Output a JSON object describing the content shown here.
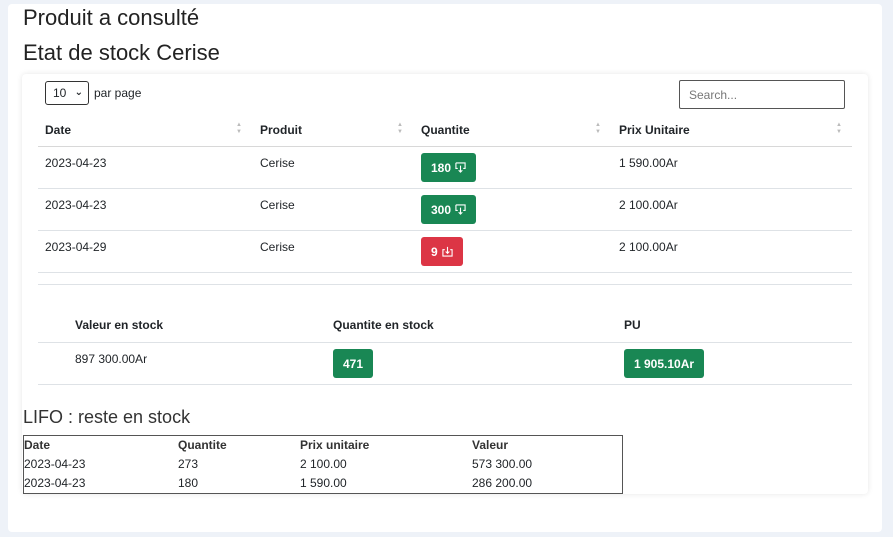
{
  "header": {
    "title": "Produit a consulté",
    "subtitle": "Etat de stock Cerise"
  },
  "controls": {
    "per_page_value": "10",
    "per_page_label": "par page",
    "search_placeholder": "Search..."
  },
  "stock_table": {
    "columns": [
      "Date",
      "Produit",
      "Quantite",
      "Prix Unitaire"
    ],
    "rows": [
      {
        "date": "2023-04-23",
        "produit": "Cerise",
        "quantite": "180",
        "type": "entree",
        "prix": "1 590.00Ar"
      },
      {
        "date": "2023-04-23",
        "produit": "Cerise",
        "quantite": "300",
        "type": "entree",
        "prix": "2 100.00Ar"
      },
      {
        "date": "2023-04-29",
        "produit": "Cerise",
        "quantite": "9",
        "type": "sortie",
        "prix": "2 100.00Ar"
      }
    ]
  },
  "summary": {
    "columns": [
      "Valeur en stock",
      "Quantite en stock",
      "PU"
    ],
    "valeur": "897 300.00Ar",
    "quantite": "471",
    "pu": "1 905.10Ar"
  },
  "lifo": {
    "title": "LIFO : reste en stock",
    "columns": [
      "Date",
      "Quantite",
      "Prix unitaire",
      "Valeur"
    ],
    "rows": [
      {
        "date": "2023-04-23",
        "quantite": "273",
        "prix": "2 100.00",
        "valeur": "573 300.00"
      },
      {
        "date": "2023-04-23",
        "quantite": "180",
        "prix": "1 590.00",
        "valeur": "286 200.00"
      }
    ]
  },
  "colors": {
    "green": "#198754",
    "red": "#dc3545"
  },
  "icons": {
    "entree": "box-arrow-in-icon",
    "sortie": "box-arrow-down-icon"
  }
}
